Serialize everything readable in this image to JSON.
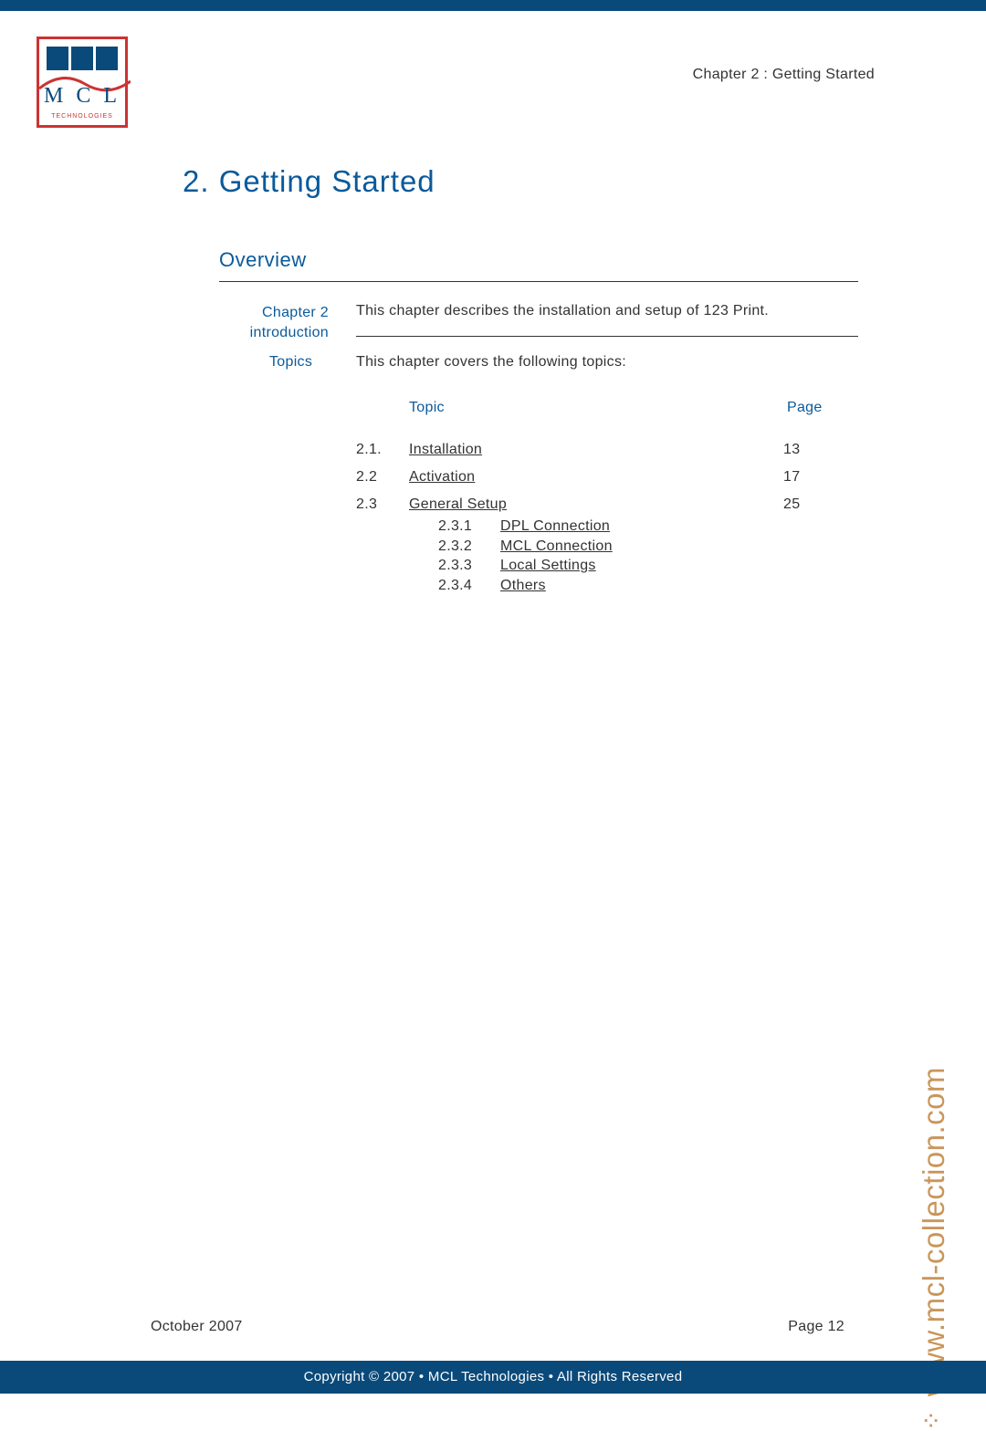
{
  "header": {
    "chapter_label": "Chapter 2 : Getting Started"
  },
  "title": "2.   Getting Started",
  "overview_heading": "Overview",
  "intro": {
    "label": "Chapter 2 introduction",
    "text": "This chapter describes the installation and setup of 123 Print."
  },
  "topics": {
    "label": "Topics",
    "text": "This chapter covers the following topics:"
  },
  "table_headers": {
    "topic": "Topic",
    "page": "Page"
  },
  "toc": [
    {
      "num": "2.1.",
      "title": "Installation",
      "page": "13"
    },
    {
      "num": "2.2",
      "title": "Activation",
      "page": "17"
    },
    {
      "num": "2.3",
      "title": "General Setup",
      "page": "25",
      "subs": [
        {
          "num": "2.3.1",
          "title": "DPL Connection"
        },
        {
          "num": "2.3.2",
          "title": "MCL Connection"
        },
        {
          "num": "2.3.3",
          "title": "Local Settings"
        },
        {
          "num": "2.3.4",
          "title": "Others"
        }
      ]
    }
  ],
  "side_url": "www.mcl-collection.com",
  "footer": {
    "date": "October 2007",
    "page": "Page 12",
    "copyright": "Copyright © 2007 • MCL Technologies • All Rights Reserved"
  },
  "logo": {
    "letters": "M C L",
    "sub": "TECHNOLOGIES"
  }
}
